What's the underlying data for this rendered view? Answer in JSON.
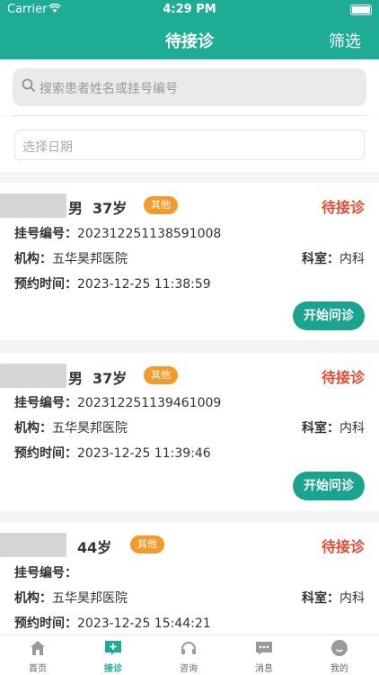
{
  "statusbar": {
    "carrier": "Carrier",
    "time": "4:29 PM"
  },
  "navbar": {
    "title": "待接诊",
    "filter_label": "筛选"
  },
  "search": {
    "placeholder": "搜索患者姓名或挂号编号"
  },
  "date_filter": {
    "placeholder": "选择日期"
  },
  "labels": {
    "reg_no": "挂号编号：",
    "institution": "机构：",
    "dept": "科室：",
    "appt_time": "预约时间：",
    "start_button": "开始问诊"
  },
  "cards": [
    {
      "gender": "男",
      "age": "37岁",
      "tag": "其他",
      "status": "待接诊",
      "reg_no": "202312251138591008",
      "institution": "五华昊邦医院",
      "dept": "内科",
      "appt_time": "2023-12-25 11:38:59"
    },
    {
      "gender": "男",
      "age": "37岁",
      "tag": "其他",
      "status": "待接诊",
      "reg_no": "202312251139461009",
      "institution": "五华昊邦医院",
      "dept": "内科",
      "appt_time": "2023-12-25 11:39:46"
    },
    {
      "gender": "",
      "age": "44岁",
      "tag": "其他",
      "status": "待接诊",
      "reg_no": "",
      "institution": "五华昊邦医院",
      "dept": "内科",
      "appt_time": "2023-12-25 15:44:21"
    }
  ],
  "tabbar": {
    "items": [
      {
        "label": "首页",
        "icon": "home-icon"
      },
      {
        "label": "接诊",
        "icon": "consult-add-icon"
      },
      {
        "label": "咨询",
        "icon": "headset-icon"
      },
      {
        "label": "消息",
        "icon": "chat-icon"
      },
      {
        "label": "我的",
        "icon": "user-icon"
      }
    ],
    "active_index": 1
  },
  "colors": {
    "primary": "#1eac95",
    "status_red": "#e04b34",
    "tag_orange": "#f39a2c",
    "button_green": "#1aa48e"
  }
}
